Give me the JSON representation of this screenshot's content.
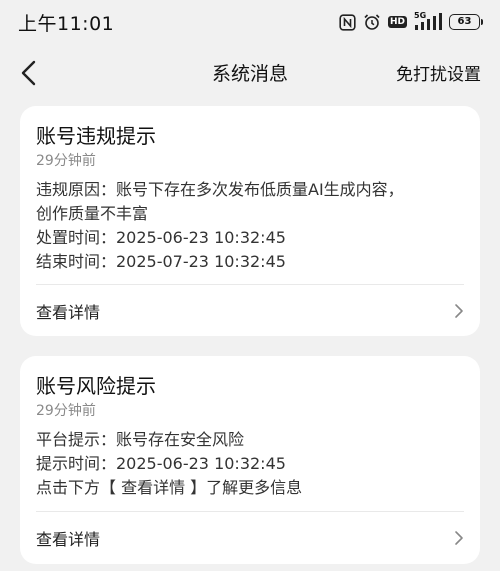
{
  "status_bar": {
    "time": "上午11:01",
    "network_label": "5G",
    "battery_level": "63",
    "icons": [
      "nfc-icon",
      "alarm-icon",
      "hd-icon",
      "signal-icon",
      "battery-icon"
    ],
    "hd_label": "HD"
  },
  "nav": {
    "back_icon": "chevron-left-icon",
    "title": "系统消息",
    "action_label": "免打扰设置"
  },
  "messages": [
    {
      "title": "账号违规提示",
      "time": "29分钟前",
      "lines": [
        "违规原因：账号下存在多次发布低质量AI生成内容，",
        "创作质量不丰富",
        "处置时间：2025-06-23 10:32:45",
        "结束时间：2025-07-23 10:32:45"
      ],
      "details_label": "查看详情"
    },
    {
      "title": "账号风险提示",
      "time": "29分钟前",
      "lines": [
        "平台提示：账号存在安全风险",
        "提示时间：2025-06-23 10:32:45",
        "点击下方【 查看详情 】了解更多信息"
      ],
      "details_label": "查看详情"
    }
  ],
  "colors": {
    "background": "#f1f1f1",
    "card": "#ffffff",
    "muted_text": "#8a8a8a"
  }
}
